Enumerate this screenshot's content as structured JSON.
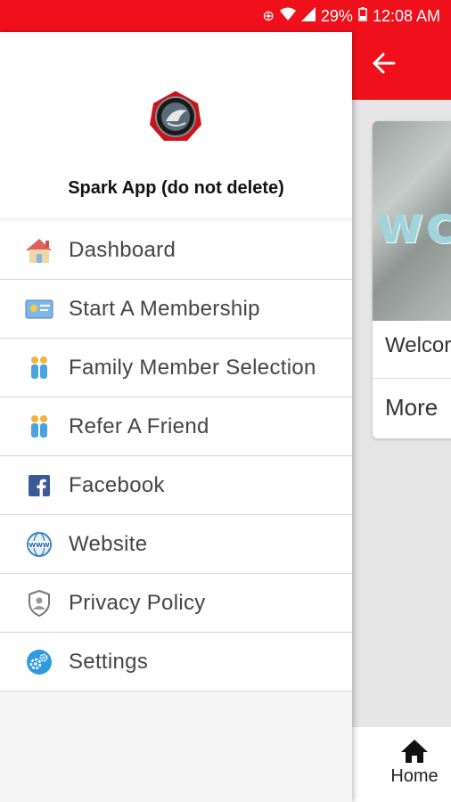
{
  "status_bar": {
    "battery": "29%",
    "time": "12:08 AM"
  },
  "drawer": {
    "app_name": "Spark App (do not delete)",
    "items": [
      {
        "label": "Dashboard",
        "icon": "house-icon"
      },
      {
        "label": "Start A Membership",
        "icon": "membership-card-icon"
      },
      {
        "label": "Family Member Selection",
        "icon": "family-icon"
      },
      {
        "label": "Refer A Friend",
        "icon": "friends-icon"
      },
      {
        "label": "Facebook",
        "icon": "facebook-icon"
      },
      {
        "label": "Website",
        "icon": "globe-www-icon"
      },
      {
        "label": "Privacy Policy",
        "icon": "shield-icon"
      },
      {
        "label": "Settings",
        "icon": "gears-icon"
      }
    ]
  },
  "background": {
    "card_welcome": "Welcor",
    "card_more": "More",
    "card_image_text": "wc",
    "bottom_nav": {
      "home_label": "Home"
    }
  },
  "colors": {
    "brand_red": "#f0101c"
  }
}
